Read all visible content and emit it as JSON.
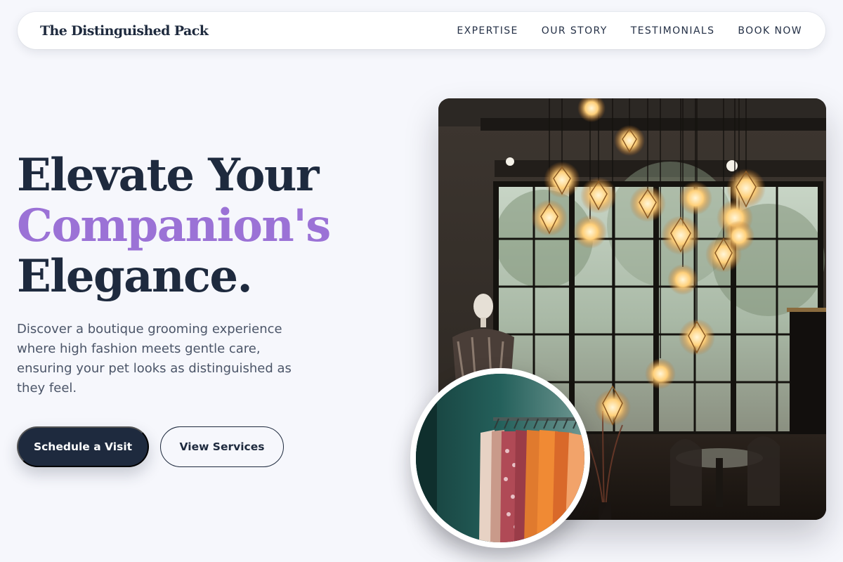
{
  "nav": {
    "brand": "The Distinguished Pack",
    "links": [
      {
        "label": "EXPERTISE"
      },
      {
        "label": "OUR STORY"
      },
      {
        "label": "TESTIMONIALS"
      },
      {
        "label": "BOOK NOW"
      }
    ]
  },
  "hero": {
    "headline_line1": "Elevate Your",
    "headline_line2": "Companion's",
    "headline_line3": "Elegance.",
    "description": "Discover a boutique grooming experience where high fashion meets gentle care, ensuring your pet looks as distinguished as they feel.",
    "primary_button": "Schedule a Visit",
    "secondary_button": "View Services"
  },
  "colors": {
    "background": "#f6f7fc",
    "ink": "#1e2a3e",
    "accent": "#9b72d6",
    "body_text": "#4b5568"
  },
  "images": {
    "hero_photo": "boutique-interior-pendant-lights",
    "inset_photo": "clothing-rack"
  }
}
